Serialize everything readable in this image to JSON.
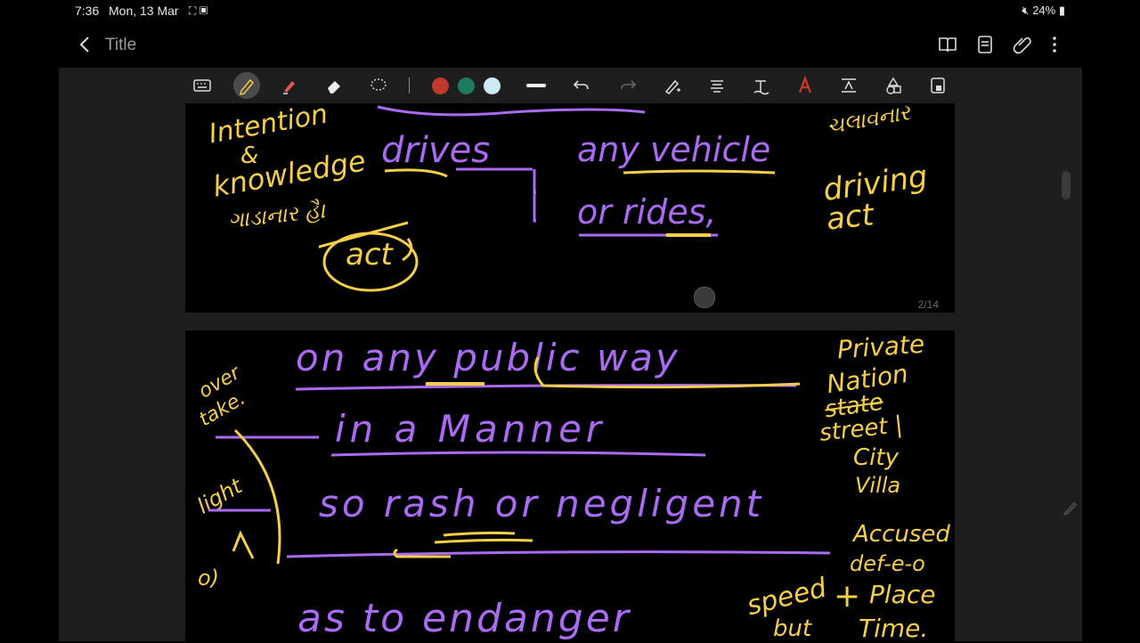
{
  "status_bar": {
    "time": "7:36",
    "date": "Mon, 13 Mar",
    "battery": "24%"
  },
  "app_bar": {
    "title": "Title"
  },
  "toolbar": {
    "colors": [
      "#c0392b",
      "#1e7a5f",
      "#cfe9f5"
    ]
  },
  "page1": {
    "page_number": "2/14",
    "notes": {
      "left1": "Intention",
      "left2": "&",
      "left3": "knowledge",
      "left4": "ગાડાનાર હૈ।",
      "left5": "act",
      "mid1": "drives",
      "mid2": "any vehicle",
      "mid3": "or rides,",
      "right1": "ચલાવનાર",
      "right2": "driving",
      "right3": "act"
    }
  },
  "page2": {
    "notes": {
      "line1": "on  any  public way",
      "line2": "in  a  Manner",
      "line3": "so  rash  or  negligent",
      "line4": "as to endanger",
      "left1": "over",
      "left2": "take.",
      "left3": "light",
      "left4": "o)",
      "right1": "Private",
      "right2": "Nation",
      "right3": "state",
      "right4": "street |",
      "right5": "City",
      "right6": "Villa",
      "right7": "Accused",
      "right8": "def-e-o",
      "right9": "Place",
      "right10": "Time.",
      "right11": "speed",
      "right12": "+",
      "right13": "but"
    }
  }
}
